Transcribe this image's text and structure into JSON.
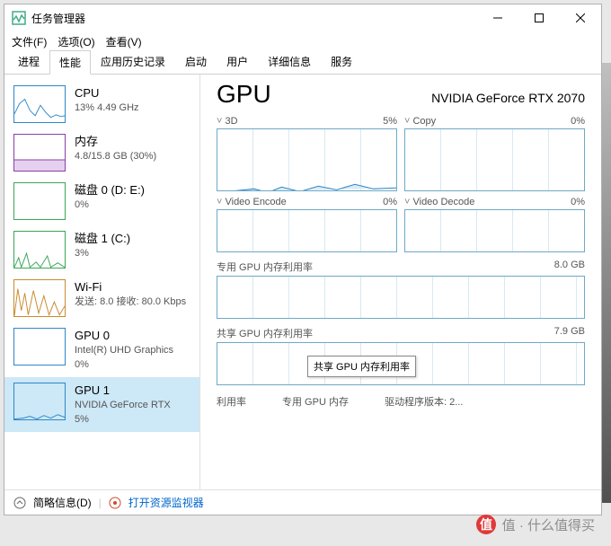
{
  "window": {
    "title": "任务管理器"
  },
  "menu": {
    "file": "文件(F)",
    "options": "选项(O)",
    "view": "查看(V)"
  },
  "tabs": [
    "进程",
    "性能",
    "应用历史记录",
    "启动",
    "用户",
    "详细信息",
    "服务"
  ],
  "sidebar": [
    {
      "title": "CPU",
      "sub": "13%  4.49 GHz",
      "color": "#2e87c8"
    },
    {
      "title": "内存",
      "sub": "4.8/15.8 GB (30%)",
      "color": "#8a3fa6"
    },
    {
      "title": "磁盘 0 (D: E:)",
      "sub": "0%",
      "color": "#3aa655"
    },
    {
      "title": "磁盘 1 (C:)",
      "sub": "3%",
      "color": "#3aa655"
    },
    {
      "title": "Wi-Fi",
      "sub": "发送: 8.0  接收: 80.0 Kbps",
      "color": "#c98a2e"
    },
    {
      "title": "GPU 0",
      "sub": "Intel(R) UHD Graphics\n0%",
      "color": "#2e87c8"
    },
    {
      "title": "GPU 1",
      "sub": "NVIDIA GeForce RTX\n5%",
      "color": "#2e87c8"
    }
  ],
  "detail": {
    "title": "GPU",
    "model": "NVIDIA GeForce RTX 2070",
    "charts": [
      {
        "name": "3D",
        "value": "5%"
      },
      {
        "name": "Copy",
        "value": "0%"
      },
      {
        "name": "Video Encode",
        "value": "0%"
      },
      {
        "name": "Video Decode",
        "value": "0%"
      }
    ],
    "mem1": {
      "label": "专用 GPU 内存利用率",
      "max": "8.0 GB"
    },
    "mem2": {
      "label": "共享 GPU 内存利用率",
      "max": "7.9 GB"
    },
    "tooltip": "共享 GPU 内存利用率",
    "stats": {
      "util_label": "利用率",
      "dedmem_label": "专用 GPU 内存",
      "driver_label": "驱动程序版本:",
      "driver_val": "2..."
    }
  },
  "statusbar": {
    "brief": "简略信息(D)",
    "monitor": "打开资源监视器"
  },
  "watermark": "值 · 什么值得买",
  "chart_data": {
    "type": "line",
    "series": [
      {
        "name": "CPU",
        "values": [
          10,
          25,
          40,
          30,
          15,
          35,
          20,
          10,
          18,
          12,
          8,
          14,
          10,
          12,
          9,
          11
        ]
      },
      {
        "name": "GPU-3D",
        "values": [
          0,
          2,
          5,
          3,
          1,
          4,
          6,
          2,
          8,
          5,
          3,
          7,
          4,
          6,
          5,
          5
        ]
      }
    ],
    "ylim": [
      0,
      100
    ]
  }
}
